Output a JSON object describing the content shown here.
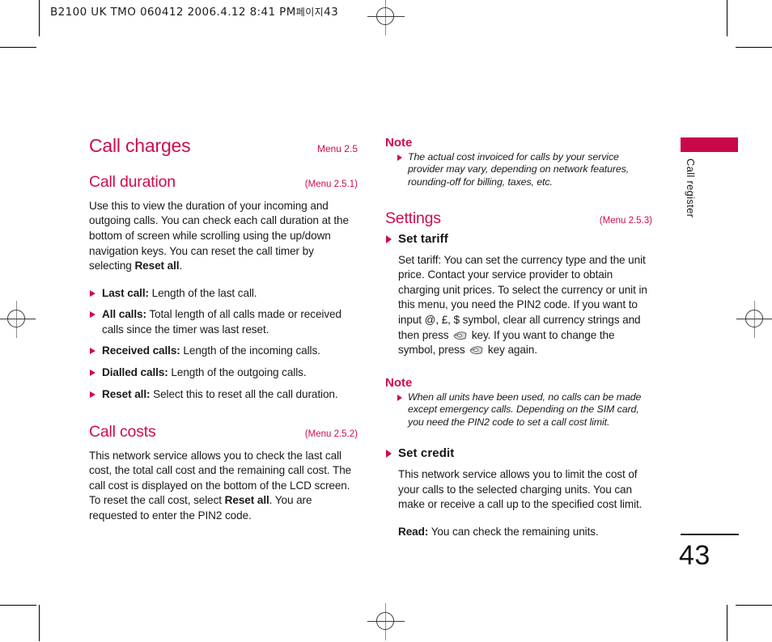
{
  "print_marks": {
    "slug_line": "B2100 UK TMO 060412  2006.4.12 8:41 PM",
    "slug_korean": "페이지",
    "slug_page": "43"
  },
  "margin_tab": {
    "label": "Call register"
  },
  "folio": {
    "page_number": "43"
  },
  "colors": {
    "accent": "#CE0B4B",
    "tab": "#C8084A",
    "text": "#1a1a1a"
  },
  "left_column": {
    "section_heading": "Call charges",
    "section_menu_tag": "Menu 2.5",
    "call_duration": {
      "heading": "Call duration",
      "menu_tag": "(Menu 2.5.1)",
      "body": "Use this to view the duration of your incoming and outgoing calls. You can check each call duration at the bottom of screen while scrolling using the up/down navigation keys. You can reset the call timer by selecting ",
      "body_bold": "Reset all",
      "body_tail": ".",
      "items": [
        {
          "label": "Last call:",
          "text": " Length of the last call."
        },
        {
          "label": "All calls:",
          "text": " Total length of all calls made or received calls since the timer was last reset."
        },
        {
          "label": "Received calls:",
          "text": " Length of the incoming calls."
        },
        {
          "label": "Dialled calls:",
          "text": " Length of the outgoing calls."
        },
        {
          "label": "Reset all:",
          "text": " Select this to reset all the call duration."
        }
      ]
    },
    "call_costs": {
      "heading": "Call costs",
      "menu_tag": "(Menu 2.5.2)",
      "body_1": "This network service allows you to check the last call cost, the total call cost and the remaining call cost. The call cost is displayed on the bottom of the LCD screen. To reset the call cost, select ",
      "body_bold": "Reset all",
      "body_2": ". You are requested to enter the PIN2 code."
    }
  },
  "right_column": {
    "note_1": {
      "title": "Note",
      "text": "The actual cost invoiced for calls by your service provider may vary, depending on network features, rounding-off for billing, taxes, etc."
    },
    "settings": {
      "heading": "Settings",
      "menu_tag": "(Menu 2.5.3)",
      "set_tariff": {
        "subheading": "Set tariff",
        "body_1": "Set tariff: You can set the currency type and the unit price. Contact your service provider to obtain charging unit prices. To select the currency or unit in this menu, you need the PIN2 code. If you want to input @, £, $ symbol, clear all currency strings and then press ",
        "key_icon_1": "clear-key-icon",
        "body_2": " key. If you want to change the symbol, press ",
        "key_icon_2": "clear-key-icon",
        "body_3": " key again."
      }
    },
    "note_2": {
      "title": "Note",
      "text": "When all units have been used, no calls can be made except emergency calls. Depending on the SIM card, you need the PIN2 code to set a call cost limit."
    },
    "set_credit": {
      "subheading": "Set credit",
      "body": "This network service allows you to limit the cost of your calls to the selected charging units. You can make or receive a call up to the specified cost limit.",
      "read_label": "Read:",
      "read_text": " You can check the remaining units."
    }
  }
}
